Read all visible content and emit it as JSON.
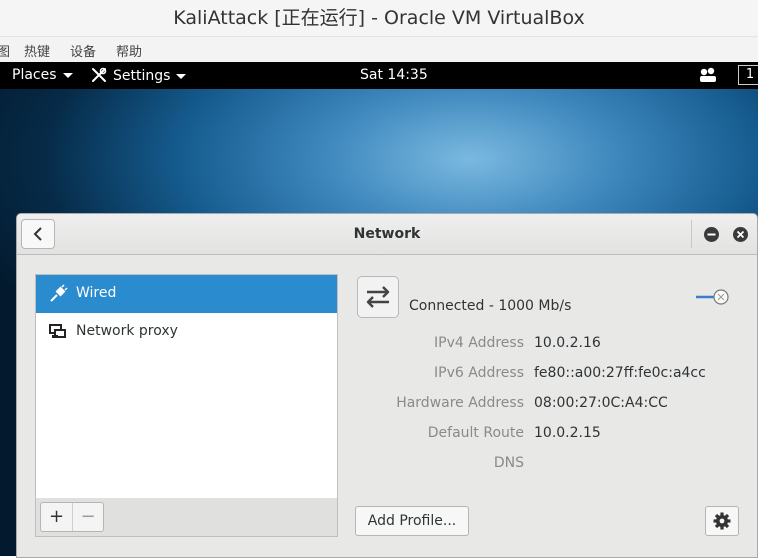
{
  "host": {
    "title": "KaliAttack [正在运行] - Oracle VM VirtualBox",
    "menu": [
      "图",
      "热键",
      "设备",
      "帮助"
    ]
  },
  "topbar": {
    "places": "Places",
    "settings": "Settings",
    "clock": "Sat 14:35",
    "workspace": "1"
  },
  "window": {
    "title": "Network",
    "list": [
      {
        "label": "Wired",
        "selected": true
      },
      {
        "label": "Network proxy",
        "selected": false
      }
    ],
    "add_symbol": "+",
    "remove_symbol": "−",
    "status": "Connected - 1000 Mb/s",
    "toggle_on": false,
    "details": [
      {
        "key": "IPv4 Address",
        "value": "10.0.2.16"
      },
      {
        "key": "IPv6 Address",
        "value": "fe80::a00:27ff:fe0c:a4cc"
      },
      {
        "key": "Hardware Address",
        "value": "08:00:27:0C:A4:CC"
      },
      {
        "key": "Default Route",
        "value": "10.0.2.15"
      },
      {
        "key": "DNS",
        "value": ""
      }
    ],
    "add_profile": "Add Profile..."
  },
  "colors": {
    "selection": "#2a8ccf",
    "topbar": "#000000"
  }
}
